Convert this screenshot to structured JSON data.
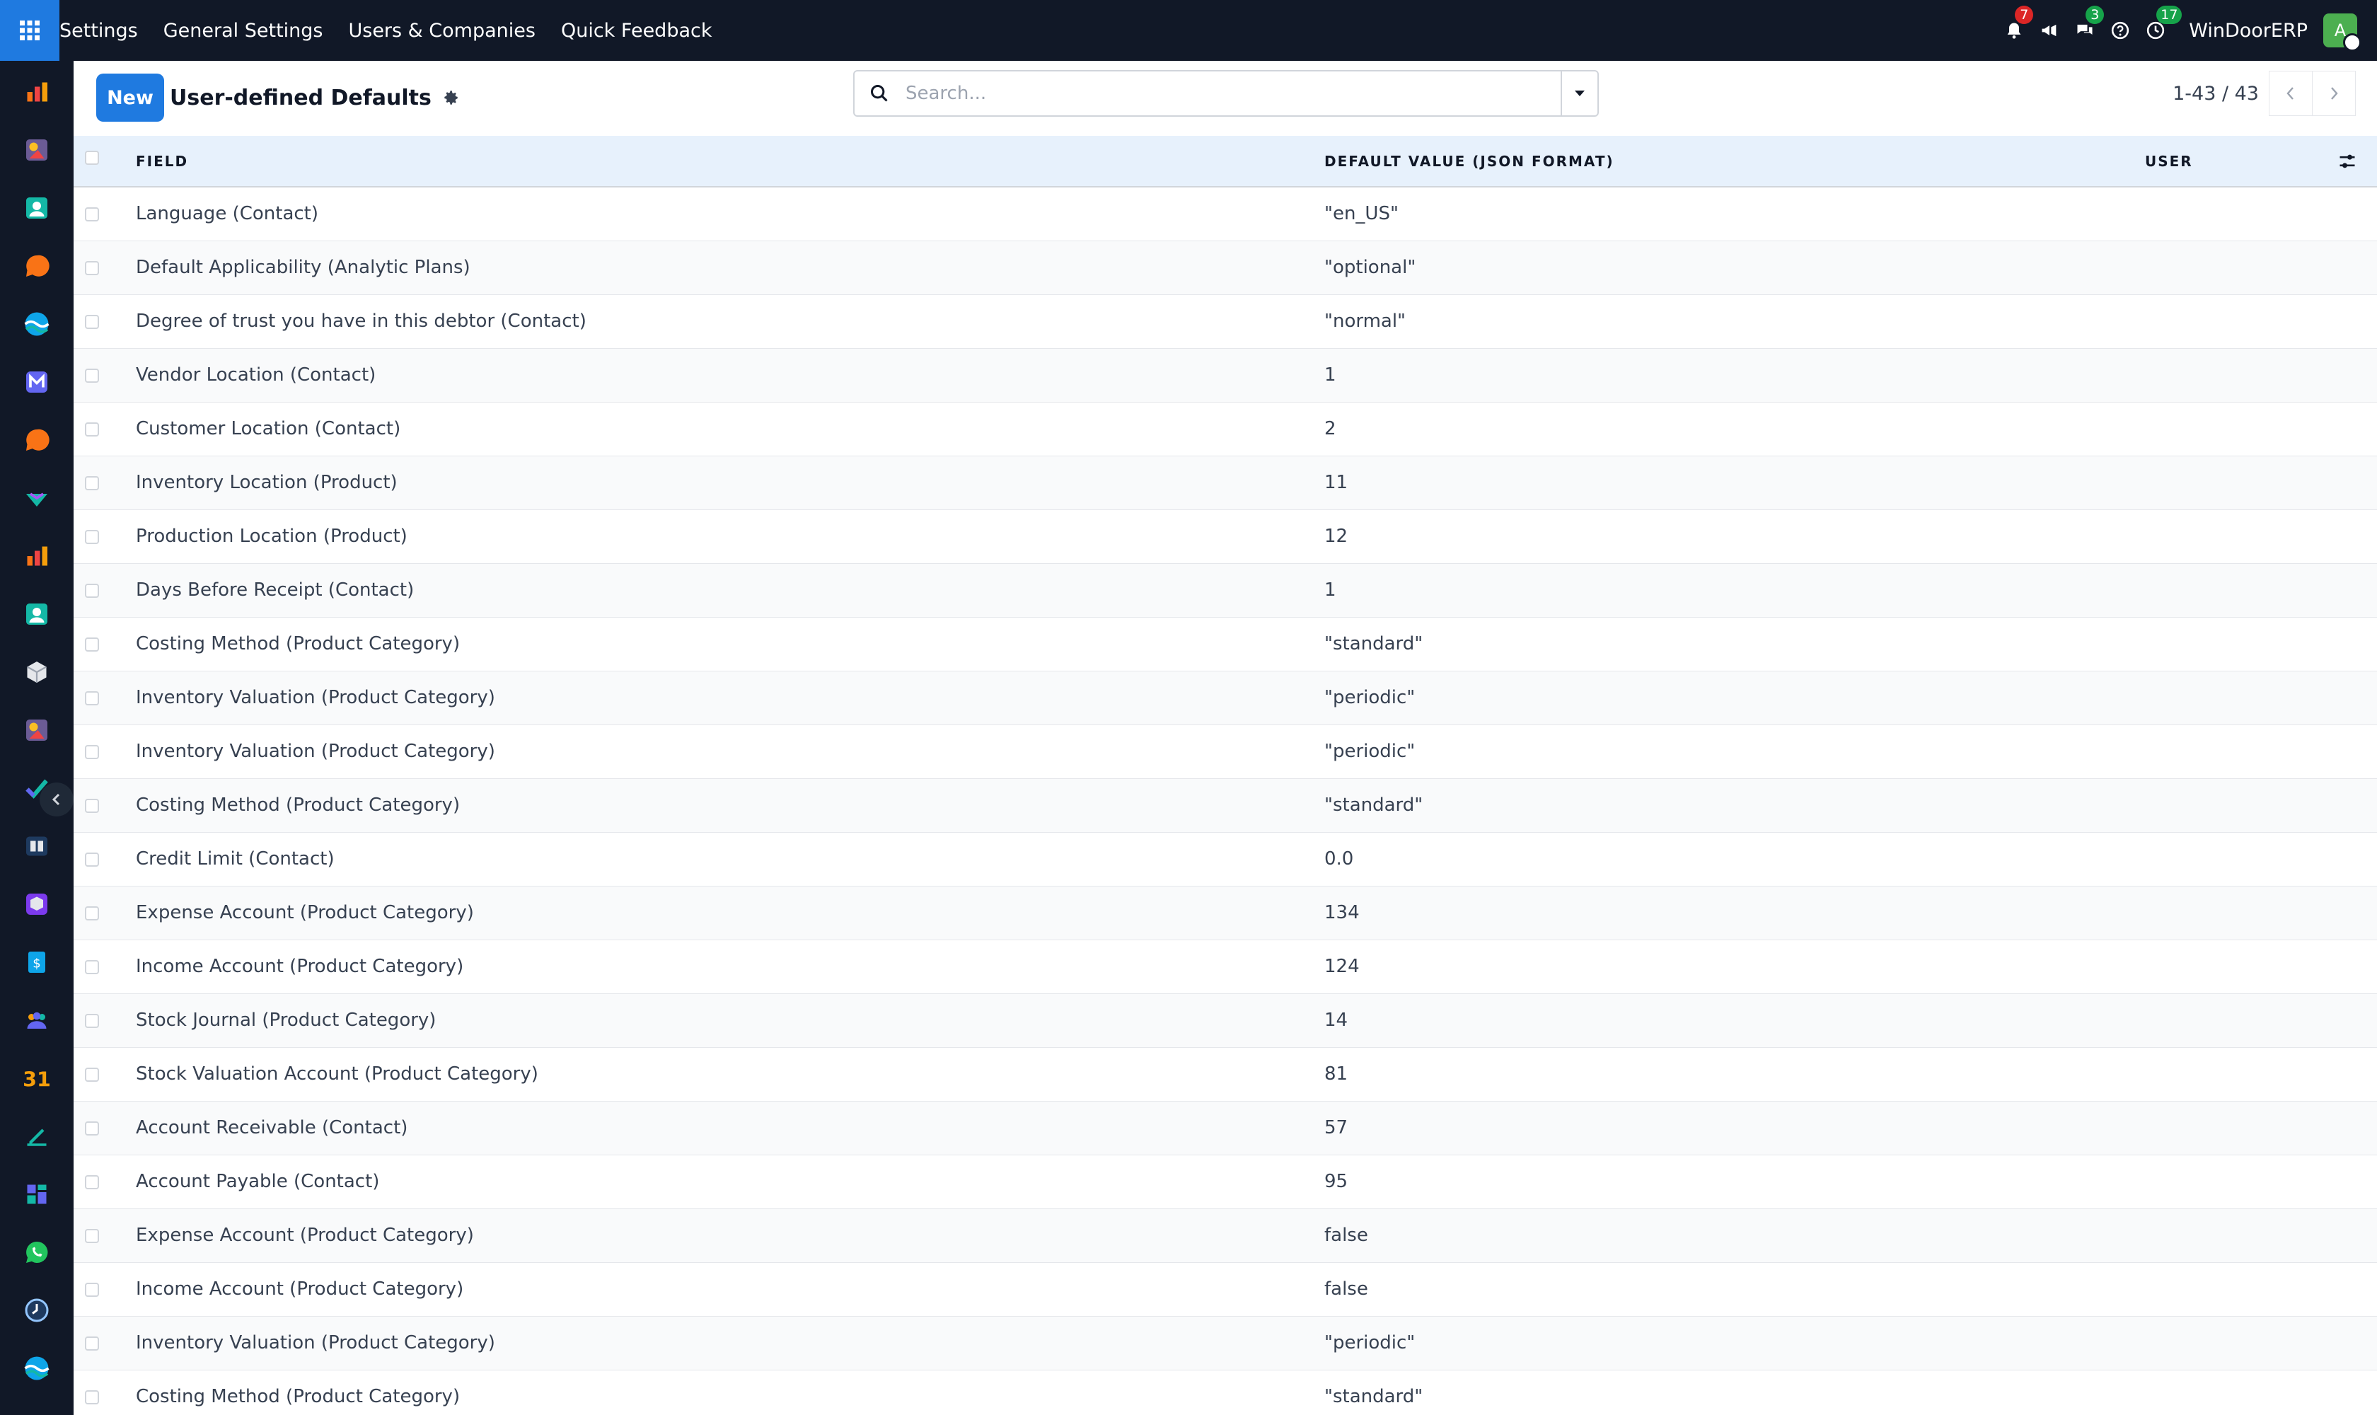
{
  "topbar": {
    "menu": [
      "Settings",
      "General Settings",
      "Users & Companies",
      "Quick Feedback"
    ],
    "notifications_count": "7",
    "messages_count": "3",
    "activities_count": "17",
    "company_name": "WinDoorERP",
    "avatar_initial": "A",
    "colors": {
      "bar": "#111827",
      "apps_button": "#1f7ae0",
      "badge_red": "#dc2626",
      "badge_green": "#16a34a"
    }
  },
  "dock": {
    "icons": [
      "sales-icon",
      "art-icon",
      "contacts-icon",
      "discuss-icon",
      "wave-icon",
      "mail-icon",
      "chat-icon",
      "check-icon",
      "reporting-icon",
      "employees-icon",
      "inventory-icon",
      "art-icon",
      "project-icon",
      "knowledge-icon",
      "box-icon",
      "invoicing-icon",
      "team-icon",
      "calendar-icon",
      "sign-icon",
      "dashboard-icon",
      "whatsapp-icon",
      "clock-icon",
      "wave-icon"
    ]
  },
  "control": {
    "new_label": "New",
    "title": "User-defined Defaults",
    "search_placeholder": "Search...",
    "pager_range": "1-43 / 43"
  },
  "table": {
    "headers": {
      "field": "FIELD",
      "default_value": "DEFAULT VALUE (JSON FORMAT)",
      "user": "USER"
    },
    "rows": [
      {
        "field": "Language (Contact)",
        "value": "\"en_US\"",
        "user": ""
      },
      {
        "field": "Default Applicability (Analytic Plans)",
        "value": "\"optional\"",
        "user": ""
      },
      {
        "field": "Degree of trust you have in this debtor (Contact)",
        "value": "\"normal\"",
        "user": ""
      },
      {
        "field": "Vendor Location (Contact)",
        "value": "1",
        "user": ""
      },
      {
        "field": "Customer Location (Contact)",
        "value": "2",
        "user": ""
      },
      {
        "field": "Inventory Location (Product)",
        "value": "11",
        "user": ""
      },
      {
        "field": "Production Location (Product)",
        "value": "12",
        "user": ""
      },
      {
        "field": "Days Before Receipt (Contact)",
        "value": "1",
        "user": ""
      },
      {
        "field": "Costing Method (Product Category)",
        "value": "\"standard\"",
        "user": ""
      },
      {
        "field": "Inventory Valuation (Product Category)",
        "value": "\"periodic\"",
        "user": ""
      },
      {
        "field": "Inventory Valuation (Product Category)",
        "value": "\"periodic\"",
        "user": ""
      },
      {
        "field": "Costing Method (Product Category)",
        "value": "\"standard\"",
        "user": ""
      },
      {
        "field": "Credit Limit (Contact)",
        "value": "0.0",
        "user": ""
      },
      {
        "field": "Expense Account (Product Category)",
        "value": "134",
        "user": ""
      },
      {
        "field": "Income Account (Product Category)",
        "value": "124",
        "user": ""
      },
      {
        "field": "Stock Journal (Product Category)",
        "value": "14",
        "user": ""
      },
      {
        "field": "Stock Valuation Account (Product Category)",
        "value": "81",
        "user": ""
      },
      {
        "field": "Account Receivable (Contact)",
        "value": "57",
        "user": ""
      },
      {
        "field": "Account Payable (Contact)",
        "value": "95",
        "user": ""
      },
      {
        "field": "Expense Account (Product Category)",
        "value": "false",
        "user": ""
      },
      {
        "field": "Income Account (Product Category)",
        "value": "false",
        "user": ""
      },
      {
        "field": "Inventory Valuation (Product Category)",
        "value": "\"periodic\"",
        "user": ""
      },
      {
        "field": "Costing Method (Product Category)",
        "value": "\"standard\"",
        "user": ""
      }
    ]
  }
}
